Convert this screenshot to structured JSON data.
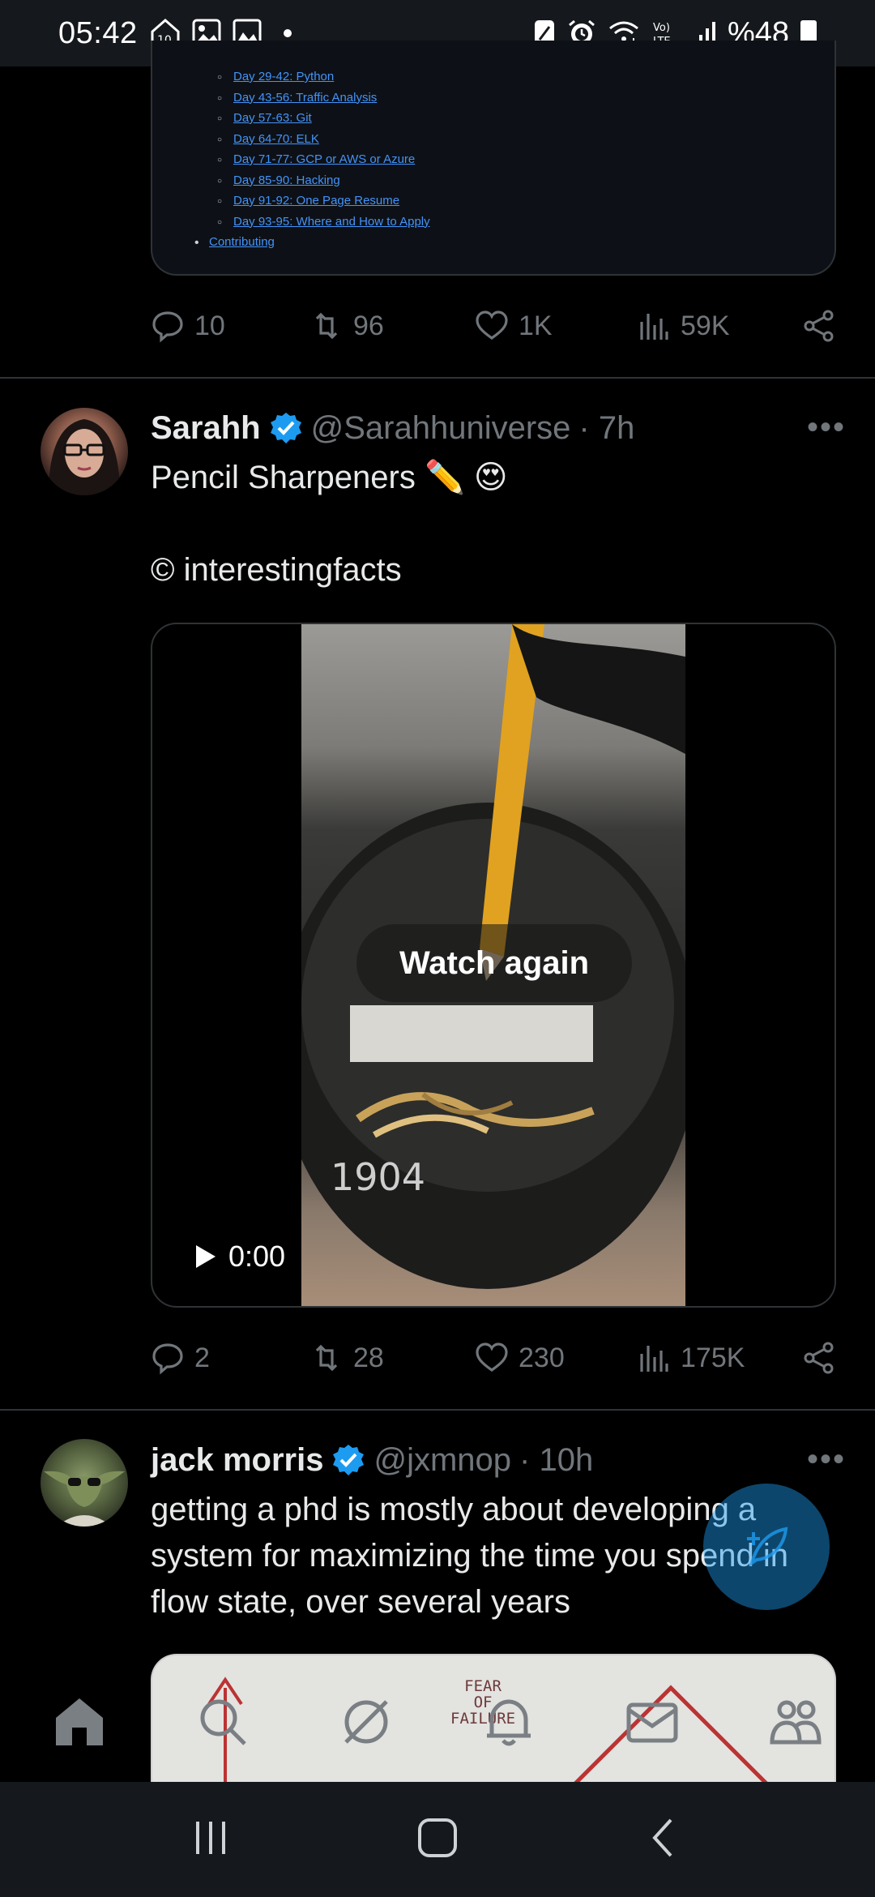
{
  "status_bar": {
    "time": "05:42",
    "battery": "%48",
    "icons": [
      "notification-10-icon",
      "gallery-icon",
      "photo-icon",
      "dot-icon",
      "app-icon",
      "alarm-icon",
      "wifi-icon",
      "volte-icon",
      "signal-icon",
      "battery-icon"
    ]
  },
  "github_card": {
    "items": [
      "Day 29-42: Python",
      "Day 43-56: Traffic Analysis",
      "Day 57-63: Git",
      "Day 64-70: ELK",
      "Day 71-77: GCP or AWS or Azure",
      "Day 85-90: Hacking",
      "Day 91-92: One Page Resume",
      "Day 93-95: Where and How to Apply"
    ],
    "top_item": "Contributing"
  },
  "tweet1_actions": {
    "replies": "10",
    "reposts": "96",
    "likes": "1K",
    "views": "59K"
  },
  "tweet2": {
    "name": "Sarahh",
    "handle": "@Sarahhuniverse",
    "time": "· 7h",
    "text": "Pencil Sharpeners ✏️ 😍\n\n© interestingfacts",
    "video": {
      "watch_again": "Watch again",
      "timestamp": "0:00",
      "overlay_number": "1904"
    },
    "actions": {
      "replies": "2",
      "reposts": "28",
      "likes": "230",
      "views": "175K"
    }
  },
  "tweet3": {
    "name": "jack morris",
    "handle": "@jxmnop",
    "time": "· 10h",
    "text": "getting a phd is mostly about developing a system for maximizing the time you spend in flow state,  over several years",
    "preview_text": "FEAR\nOF\nFAILURE"
  },
  "colors": {
    "accent": "#1d9bf0",
    "muted": "#71767b",
    "divider": "#2f3336",
    "bg": "#000000"
  }
}
